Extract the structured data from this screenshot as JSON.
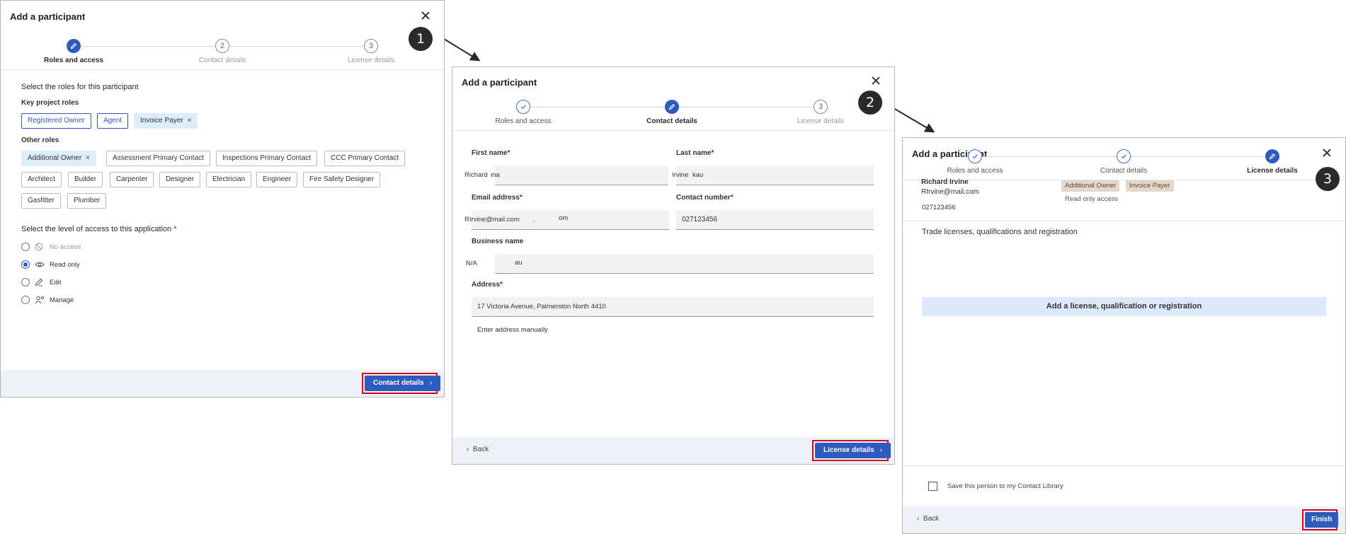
{
  "dialog1": {
    "title": "Add a participant",
    "steps": [
      {
        "num": "1",
        "label": "Roles and access",
        "state": "active"
      },
      {
        "num": "2",
        "label": "Contact details",
        "state": "todo"
      },
      {
        "num": "3",
        "label": "License details",
        "state": "todo"
      }
    ],
    "roles_prompt": "Select the roles for this participant",
    "key_roles_label": "Key project roles",
    "key_roles": [
      {
        "label": "Registered Owner",
        "state": "outlined"
      },
      {
        "label": "Agent",
        "state": "outlined"
      },
      {
        "label": "Invoice Payer",
        "state": "selected",
        "remove": "×"
      }
    ],
    "other_roles_label": "Other roles",
    "other_roles": [
      {
        "label": "Additional Owner",
        "state": "selected",
        "remove": "×"
      },
      {
        "label": "Assessment Primary Contact",
        "state": "plain"
      },
      {
        "label": "Inspections Primary Contact",
        "state": "plain"
      },
      {
        "label": "CCC Primary Contact",
        "state": "plain"
      },
      {
        "label": "Architect",
        "state": "plain"
      },
      {
        "label": "Builder",
        "state": "plain"
      },
      {
        "label": "Carpenter",
        "state": "plain"
      },
      {
        "label": "Designer",
        "state": "plain"
      },
      {
        "label": "Electrician",
        "state": "plain"
      },
      {
        "label": "Engineer",
        "state": "plain"
      },
      {
        "label": "Fire Safety Designer",
        "state": "plain"
      },
      {
        "label": "Gasfitter",
        "state": "plain"
      },
      {
        "label": "Plumber",
        "state": "plain"
      }
    ],
    "access_prompt": "Select the level of access to this application",
    "required_mark": "*",
    "access_options": [
      {
        "label": "No access",
        "icon": "no-access-icon",
        "checked": false,
        "disabled": true
      },
      {
        "label": "Read only",
        "icon": "eye-icon",
        "checked": true,
        "disabled": false
      },
      {
        "label": "Edit",
        "icon": "pencil-icon",
        "checked": false,
        "disabled": false
      },
      {
        "label": "Manage",
        "icon": "manage-users-icon",
        "checked": false,
        "disabled": false
      }
    ],
    "next_button": "Contact details",
    "chevron": "›"
  },
  "dialog2": {
    "title": "Add a participant",
    "steps": [
      {
        "num": "1",
        "label": "Roles and access",
        "state": "done"
      },
      {
        "num": "2",
        "label": "Contact details",
        "state": "active"
      },
      {
        "num": "3",
        "label": "License details",
        "state": "todo"
      }
    ],
    "first_name_label": "First name",
    "first_name_value": "Richard",
    "first_name_ghost": "ina",
    "last_name_label": "Last name",
    "last_name_value": "Irvine",
    "last_name_ghost": "kau",
    "email_label": "Email address",
    "email_value": "RIrvine@mail.com",
    "email_ghost_1": ".",
    "email_ghost_2": "om",
    "contact_label": "Contact number",
    "contact_value": "027123456",
    "business_label": "Business name",
    "business_value": "N/A",
    "business_ghost": "au",
    "address_label": "Address",
    "address_value": "17 Victoria Avenue, Palmerston North 4410",
    "address_manual": "Enter address manually",
    "required_mark": "*",
    "back_label": "Back",
    "back_chevron": "‹",
    "next_button": "License details",
    "chevron": "›"
  },
  "dialog3": {
    "title": "Add a participant",
    "steps": [
      {
        "num": "1",
        "label": "Roles and access",
        "state": "done"
      },
      {
        "num": "2",
        "label": "Contact details",
        "state": "done"
      },
      {
        "num": "3",
        "label": "License details",
        "state": "active"
      }
    ],
    "person_name": "Richard Irvine",
    "person_email": "RIrvine@mail.com",
    "person_phone": "027123456",
    "roles": [
      "Additional Owner",
      "Invoice Payer"
    ],
    "access": "Read only access",
    "trade_title": "Trade licenses, qualifications and registration",
    "add_button": "Add a license, qualification or registration",
    "save_contact": "Save this person to my Contact Library",
    "back_label": "Back",
    "back_chevron": "‹",
    "finish_button": "Finish"
  },
  "badges": [
    "1",
    "2",
    "3"
  ],
  "colors": {
    "primary": "#2f5bbf",
    "highlight": "#d0021b",
    "chip_selected": "#dceef9",
    "tag": "#e6d6c9",
    "add_button_bg": "#dce9fb"
  }
}
